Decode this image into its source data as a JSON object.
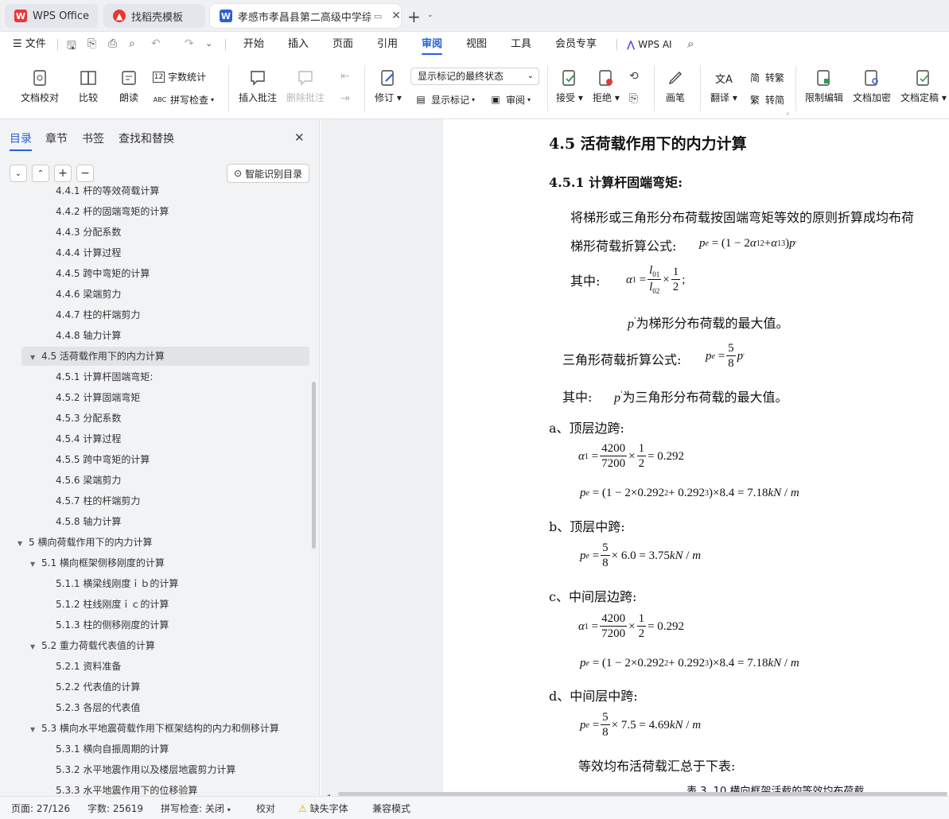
{
  "tabs": [
    {
      "label": "WPS Office",
      "icon": "wps-logo-icon"
    },
    {
      "label": "找稻壳模板",
      "icon": "docer-icon"
    },
    {
      "label": "孝感市孝昌县第二高级中学综",
      "icon": "word-doc-icon"
    }
  ],
  "menu": {
    "file": "文件",
    "items": [
      "开始",
      "插入",
      "页面",
      "引用",
      "审阅",
      "视图",
      "工具",
      "会员专享"
    ],
    "active": "审阅",
    "ai": "WPS AI"
  },
  "ribbon": {
    "proof": "文档校对",
    "compare": "比较",
    "read": "朗读",
    "wordcount": "字数统计",
    "spellcheck": "拼写检查",
    "insert_comment": "插入批注",
    "delete_comment": "删除批注",
    "revise": "修订",
    "markup_select": "显示标记的最终状态",
    "show_markup": "显示标记",
    "review_pane": "审阅",
    "accept": "接受",
    "reject": "拒绝",
    "pen": "画笔",
    "translate": "翻译",
    "to_trad": "转繁",
    "to_simp": "转简",
    "restrict": "限制编辑",
    "encrypt": "文档加密",
    "finalize": "文档定稿"
  },
  "sidebar": {
    "tabs": [
      "目录",
      "章节",
      "书签",
      "查找和替换"
    ],
    "smart_toc": "智能识别目录",
    "toc": [
      {
        "label": "4.4.1 杆的等效荷载计算",
        "level": 3
      },
      {
        "label": "4.4.2 杆的固端弯矩的计算",
        "level": 3
      },
      {
        "label": "4.4.3 分配系数",
        "level": 3
      },
      {
        "label": "4.4.4 计算过程",
        "level": 3
      },
      {
        "label": "4.4.5 跨中弯矩的计算",
        "level": 3
      },
      {
        "label": "4.4.6 梁端剪力",
        "level": 3
      },
      {
        "label": "4.4.7 柱的杆端剪力",
        "level": 3
      },
      {
        "label": "4.4.8 轴力计算",
        "level": 3
      },
      {
        "label": "4.5 活荷载作用下的内力计算",
        "level": 2,
        "expanded": true,
        "selected": true
      },
      {
        "label": "4.5.1 计算杆固端弯矩:",
        "level": 3
      },
      {
        "label": "4.5.2 计算固端弯矩",
        "level": 3
      },
      {
        "label": "4.5.3 分配系数",
        "level": 3
      },
      {
        "label": "4.5.4 计算过程",
        "level": 3
      },
      {
        "label": "4.5.5 跨中弯矩的计算",
        "level": 3
      },
      {
        "label": "4.5.6 梁端剪力",
        "level": 3
      },
      {
        "label": "4.5.7 柱的杆端剪力",
        "level": 3
      },
      {
        "label": "4.5.8 轴力计算",
        "level": 3
      },
      {
        "label": "5 横向荷载作用下的内力计算",
        "level": 1,
        "expanded": true
      },
      {
        "label": "5.1 横向框架侧移刚度的计算",
        "level": 2,
        "expanded": true
      },
      {
        "label": "5.1.1 横梁线刚度ｉｂ的计算",
        "level": 3
      },
      {
        "label": "5.1.2 柱线刚度ｉｃ的计算",
        "level": 3
      },
      {
        "label": "5.1.3 柱的侧移刚度的计算",
        "level": 3
      },
      {
        "label": "5.2 重力荷载代表值的计算",
        "level": 2,
        "expanded": true
      },
      {
        "label": "5.2.1 资料准备",
        "level": 3
      },
      {
        "label": "5.2.2 代表值的计算",
        "level": 3
      },
      {
        "label": "5.2.3 各层的代表值",
        "level": 3
      },
      {
        "label": "5.3 横向水平地震荷载作用下框架结构的内力和侧移计算",
        "level": 2,
        "expanded": true
      },
      {
        "label": "5.3.1 横向自振周期的计算",
        "level": 3
      },
      {
        "label": "5.3.2 水平地震作用以及楼层地震剪力计算",
        "level": 3
      },
      {
        "label": "5.3.3 水平地震作用下的位移验算",
        "level": 3
      }
    ]
  },
  "doc": {
    "h2_marker": "H₂",
    "heading": "4.5 活荷载作用下的内力计算",
    "subheading": "4.5.1 计算杆固端弯矩:",
    "para1": "将梯形或三角形分布荷载按固端弯矩等效的原则折算成均布荷",
    "trap_label": "梯形荷载折算公式:",
    "where1": "其中:",
    "pmax_trap": "为梯形分布荷载的最大值。",
    "tri_label": "三角形荷载折算公式:",
    "where2": "其中:",
    "pmax_tri": "为三角形分布荷载的最大值。",
    "case_a": "a、顶层边跨:",
    "case_b": "b、顶层中跨:",
    "case_c": "c、中间层边跨:",
    "case_d": "d、中间层中跨:",
    "summary": "等效均布活荷载汇总于下表:",
    "table_caption": "表 3. 10 横向框架活载的等效均布荷载",
    "a_alpha_num": "4200",
    "a_alpha_den": "7200",
    "a_alpha_val": "= 0.292",
    "a_pe": "p<sub>e</sub> = (1 − 2×0.292<sup>2</sup> + 0.292<sup>3</sup>)×8.4 = 7.18<i>kN</i> / <i>m</i>",
    "b_pe_tail": "× 6.0 = 3.75",
    "c_alpha_num": "4200",
    "c_alpha_den": "7200",
    "c_alpha_val": "= 0.292",
    "d_pe_tail": "× 7.5 = 4.69"
  },
  "status": {
    "page": "页面: 27/126",
    "words": "字数: 25619",
    "spell": "拼写检查: 关闭",
    "proof": "校对",
    "missing_font": "缺失字体",
    "compat": "兼容模式"
  }
}
